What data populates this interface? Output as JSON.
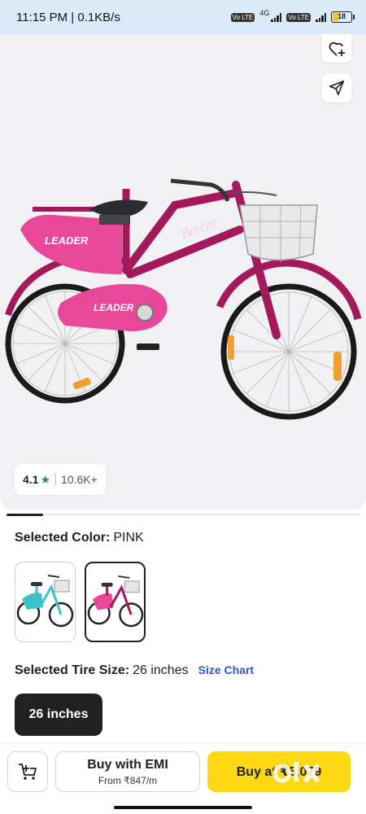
{
  "status_bar": {
    "time_speed": "11:15 PM | 0.1KB/s",
    "sim1_tag": "Vo LTE",
    "network_type": "4G",
    "sim2_tag": "Vo LTE",
    "battery_level": "18"
  },
  "product": {
    "rating": "4.1",
    "rating_star_icon": "star-icon",
    "rating_count": "10.6K+",
    "gallery_position": 1,
    "brand_text_on_image": "LEADER",
    "model_text_on_image": "Breeze"
  },
  "selection": {
    "color_label": "Selected Color:",
    "color_value": "PINK",
    "tire_label": "Selected Tire Size:",
    "tire_value": "26 inches",
    "size_chart_link": "Size Chart",
    "size_chip": "26 inches"
  },
  "bottom_bar": {
    "emi_title": "Buy with EMI",
    "emi_subtitle": "From ₹847/m",
    "buy_label": "Buy at ₹5,079",
    "watermark": "olx"
  },
  "colors": {
    "accent_yellow": "#ffd814",
    "link_blue": "#2a55e5",
    "rating_green": "#388e3c",
    "bike_frame": "#a3195b",
    "bike_pink": "#e8479a",
    "bike_teal": "#3cc3c9"
  }
}
